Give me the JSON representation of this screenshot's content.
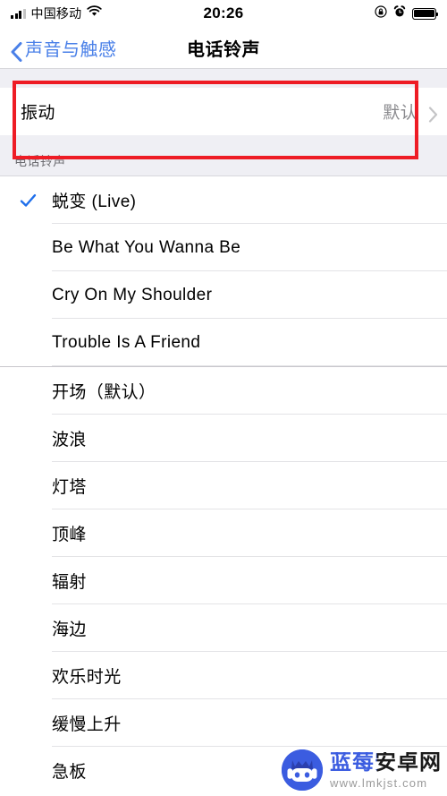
{
  "status_bar": {
    "carrier": "中国移动",
    "time": "20:26",
    "wifi_icon": "wifi-icon",
    "signal_icon": "signal-bars-icon",
    "rotation_lock_icon": "rotation-lock-icon",
    "alarm_icon": "alarm-clock-icon",
    "battery_icon": "battery-full-icon",
    "battery_level": 100
  },
  "nav": {
    "back_label": "声音与触感",
    "back_icon": "chevron-left-icon",
    "title": "电话铃声"
  },
  "vibration_row": {
    "label": "振动",
    "value": "默认",
    "chevron_icon": "chevron-right-icon",
    "highlight_color": "#ee1c25"
  },
  "section": {
    "header": "电话铃声"
  },
  "ringtones": [
    {
      "label": "蜕变 (Live)",
      "selected": true,
      "group": 1
    },
    {
      "label": "Be What You Wanna Be",
      "selected": false,
      "group": 1
    },
    {
      "label": "Cry On My Shoulder",
      "selected": false,
      "group": 1
    },
    {
      "label": "Trouble Is A Friend",
      "selected": false,
      "group": 1
    },
    {
      "label": "开场（默认）",
      "selected": false,
      "group": 2
    },
    {
      "label": "波浪",
      "selected": false,
      "group": 2
    },
    {
      "label": "灯塔",
      "selected": false,
      "group": 2
    },
    {
      "label": "顶峰",
      "selected": false,
      "group": 2
    },
    {
      "label": "辐射",
      "selected": false,
      "group": 2
    },
    {
      "label": "海边",
      "selected": false,
      "group": 2
    },
    {
      "label": "欢乐时光",
      "selected": false,
      "group": 2
    },
    {
      "label": "缓慢上升",
      "selected": false,
      "group": 2
    },
    {
      "label": "急板",
      "selected": false,
      "group": 2
    }
  ],
  "checkmark_color": "#1f6feb",
  "watermark": {
    "title": "蓝莓安卓网",
    "url": "www.lmkjst.com",
    "logo_icon": "android-robot-logo-icon"
  }
}
